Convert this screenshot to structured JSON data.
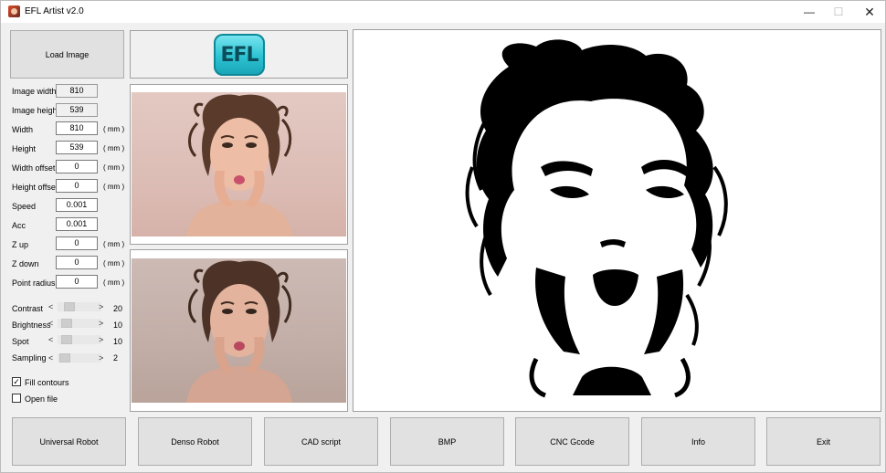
{
  "window": {
    "title": "EFL Artist v2.0",
    "minimize": "—",
    "maximize": "☐",
    "close": "✕"
  },
  "load_button": "Load Image",
  "logo_text": "EFL",
  "fields": [
    {
      "label": "Image width",
      "value": "810",
      "unit": ""
    },
    {
      "label": "Image height",
      "value": "539",
      "unit": ""
    },
    {
      "label": "Width",
      "value": "810",
      "unit": "( mm )"
    },
    {
      "label": "Height",
      "value": "539",
      "unit": "( mm )"
    },
    {
      "label": "Width offset",
      "value": "0",
      "unit": "( mm )"
    },
    {
      "label": "Height offset",
      "value": "0",
      "unit": "( mm )"
    },
    {
      "label": "Speed",
      "value": "0.001",
      "unit": ""
    },
    {
      "label": "Acc",
      "value": "0.001",
      "unit": ""
    },
    {
      "label": "Z up",
      "value": "0",
      "unit": "( mm )"
    },
    {
      "label": "Z down",
      "value": "0",
      "unit": "( mm )"
    },
    {
      "label": "Point radius",
      "value": "0",
      "unit": "( mm )"
    }
  ],
  "sliders": [
    {
      "label": "Contrast",
      "value": "20",
      "level": 0.2
    },
    {
      "label": "Brightness",
      "value": "10",
      "level": 0.1
    },
    {
      "label": "Spot",
      "value": "10",
      "level": 0.1
    },
    {
      "label": "Sampling",
      "value": "2",
      "level": 0.05
    }
  ],
  "slider_arrows": {
    "left": "<",
    "right": ">"
  },
  "checkboxes": [
    {
      "label": "Fill contours",
      "checked": true,
      "mark": "✓"
    },
    {
      "label": "Open file",
      "checked": false,
      "mark": ""
    }
  ],
  "bottom_buttons": [
    "Universal Robot",
    "Denso Robot",
    "CAD script",
    "BMP",
    "CNC Gcode",
    "Info",
    "Exit"
  ]
}
